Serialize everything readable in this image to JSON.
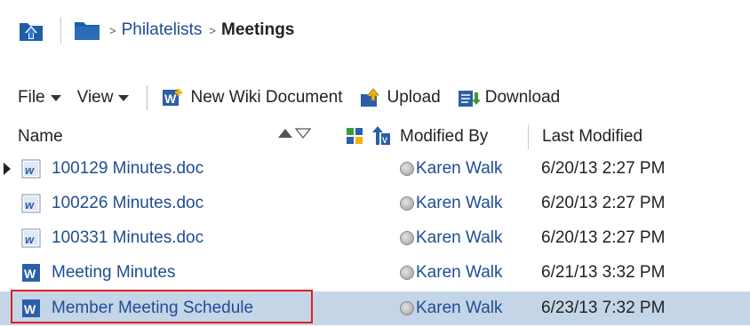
{
  "breadcrumb": {
    "separator": ">",
    "parent": "Philatelists",
    "current": "Meetings"
  },
  "toolbar": {
    "file_label": "File",
    "view_label": "View",
    "new_wiki_label": "New Wiki Document",
    "upload_label": "Upload",
    "download_label": "Download"
  },
  "columns": {
    "name": "Name",
    "modified_by": "Modified By",
    "last_modified": "Last Modified"
  },
  "rows": [
    {
      "name": "100129 Minutes.doc",
      "modified_by": "Karen Walk",
      "last_modified": "6/20/13 2:27 PM",
      "type": "doc"
    },
    {
      "name": "100226 Minutes.doc",
      "modified_by": "Karen Walk",
      "last_modified": "6/20/13 2:27 PM",
      "type": "doc"
    },
    {
      "name": "100331 Minutes.doc",
      "modified_by": "Karen Walk",
      "last_modified": "6/20/13 2:27 PM",
      "type": "doc"
    },
    {
      "name": "Meeting Minutes",
      "modified_by": "Karen Walk",
      "last_modified": "6/21/13 3:32 PM",
      "type": "wiki"
    },
    {
      "name": "Member Meeting Schedule",
      "modified_by": "Karen Walk",
      "last_modified": "6/23/13 7:32 PM",
      "type": "wiki"
    }
  ],
  "colors": {
    "link": "#1f4d94",
    "selection": "#c5d5e8",
    "highlight_border": "#e02020"
  }
}
